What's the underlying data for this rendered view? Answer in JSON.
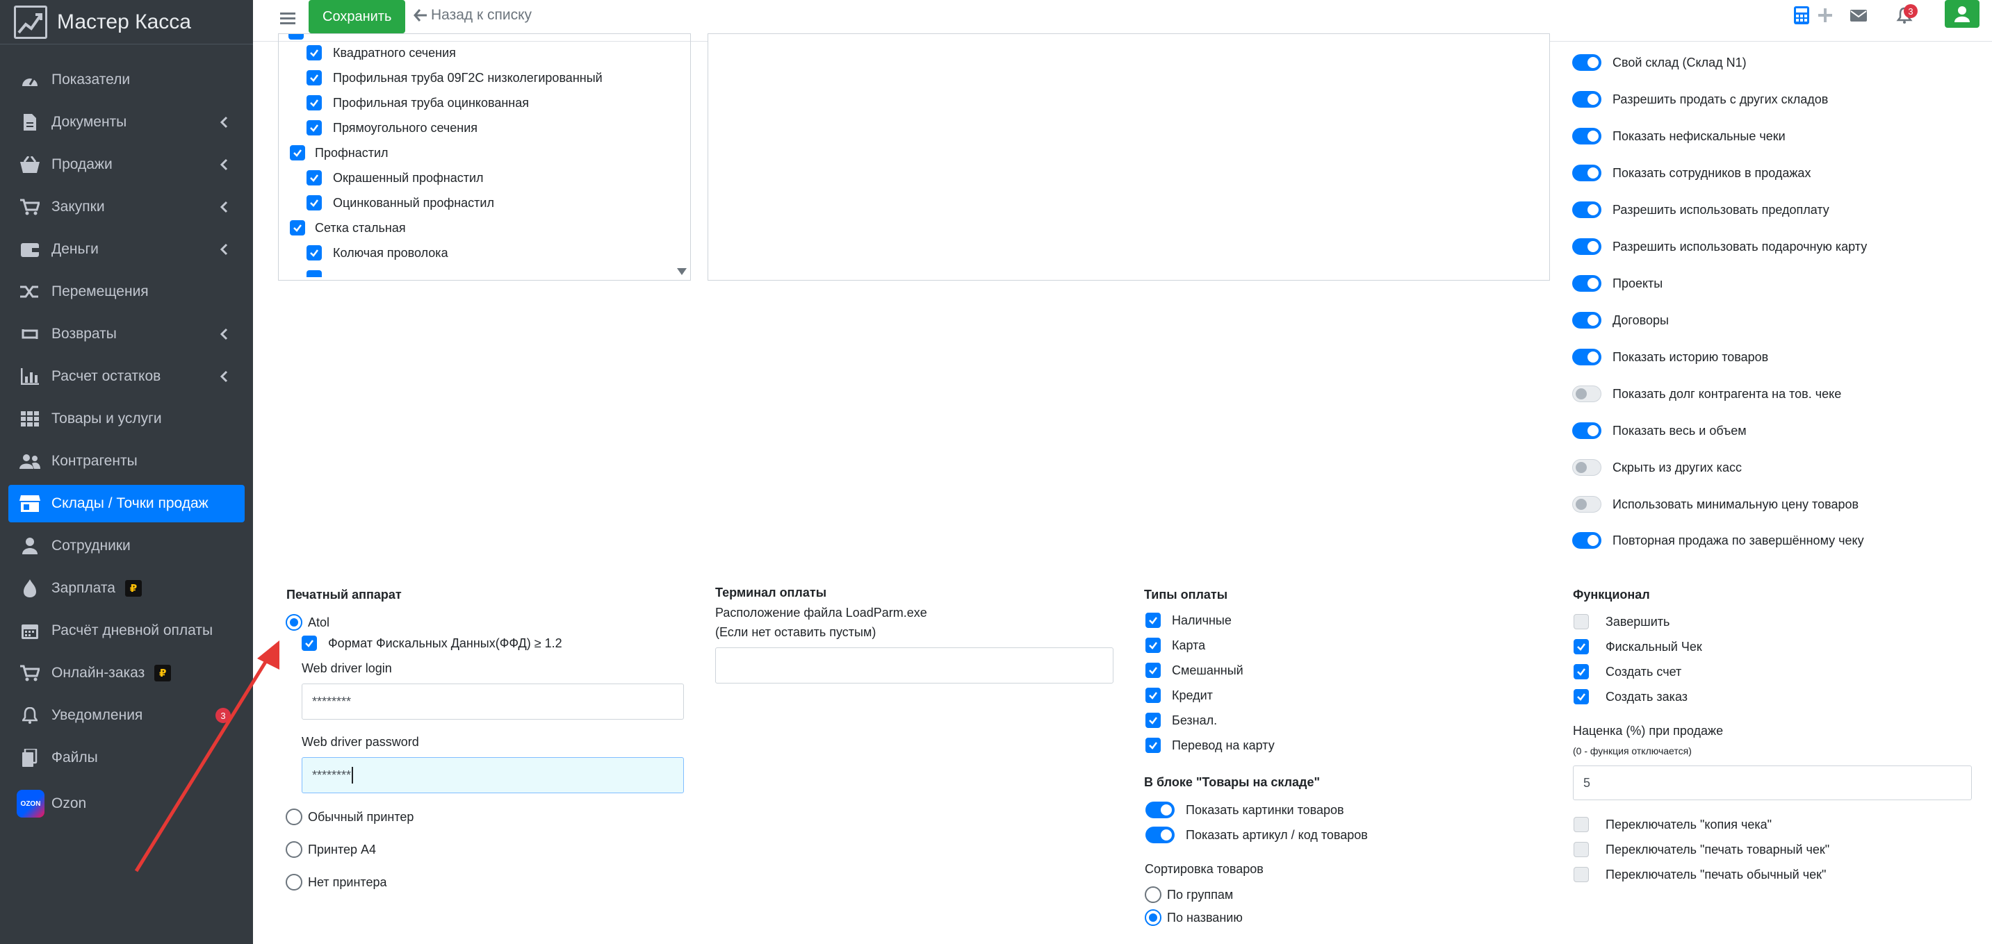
{
  "brand": {
    "name": "Мастер Касса"
  },
  "sidebar": {
    "items": [
      {
        "label": "Показатели",
        "icon": "gauge-icon"
      },
      {
        "label": "Документы",
        "icon": "file-icon",
        "has_children": true
      },
      {
        "label": "Продажи",
        "icon": "basket-icon",
        "has_children": true
      },
      {
        "label": "Закупки",
        "icon": "cart-icon",
        "has_children": true
      },
      {
        "label": "Деньги",
        "icon": "wallet-icon",
        "has_children": true
      },
      {
        "label": "Перемещения",
        "icon": "shuffle-icon"
      },
      {
        "label": "Возвраты",
        "icon": "return-icon",
        "has_children": true
      },
      {
        "label": "Расчет остатков",
        "icon": "chart-icon",
        "has_children": true
      },
      {
        "label": "Товары и услуги",
        "icon": "grid-icon"
      },
      {
        "label": "Контрагенты",
        "icon": "users-icon"
      },
      {
        "label": "Склады / Точки продаж",
        "icon": "store-icon",
        "active": true
      },
      {
        "label": "Сотрудники",
        "icon": "user-icon"
      },
      {
        "label": "Зарплата",
        "icon": "money-icon",
        "rub": "₽"
      },
      {
        "label": "Расчёт дневной оплаты",
        "icon": "calendar-icon"
      },
      {
        "label": "Онлайн-заказ",
        "icon": "cart-icon",
        "rub": "₽"
      },
      {
        "label": "Уведомления",
        "icon": "bell-icon",
        "badge": "3"
      },
      {
        "label": "Файлы",
        "icon": "folder-icon"
      },
      {
        "label": "Ozon",
        "icon": "ozon-logo",
        "logo_text": "OZON"
      }
    ]
  },
  "header": {
    "save_label": "Сохранить",
    "back_label": "Назад к списку",
    "notif_count": "3"
  },
  "category_tree": [
    {
      "label": "Квадратного сечения",
      "level": 2,
      "checked": true
    },
    {
      "label": "Профильная труба 09Г2С низколегированный",
      "level": 2,
      "checked": true
    },
    {
      "label": "Профильная труба оцинкованная",
      "level": 2,
      "checked": true
    },
    {
      "label": "Прямоугольного сечения",
      "level": 2,
      "checked": true
    },
    {
      "label": "Профнастил",
      "level": 1,
      "checked": true
    },
    {
      "label": "Окрашенный профнастил",
      "level": 2,
      "checked": true
    },
    {
      "label": "Оцинкованный профнастил",
      "level": 2,
      "checked": true
    },
    {
      "label": "Сетка стальная",
      "level": 1,
      "checked": true
    },
    {
      "label": "Колючая проволока",
      "level": 2,
      "checked": true
    }
  ],
  "toggles": [
    {
      "label": "Свой склад (Склад N1)",
      "on": true
    },
    {
      "label": "Разрешить продать с других складов",
      "on": true
    },
    {
      "label": "Показать нефискальные чеки",
      "on": true
    },
    {
      "label": "Показать сотрудников в продажах",
      "on": true
    },
    {
      "label": "Разрешить использовать предоплату",
      "on": true
    },
    {
      "label": "Разрешить использовать подарочную карту",
      "on": true
    },
    {
      "label": "Проекты",
      "on": true
    },
    {
      "label": "Договоры",
      "on": true
    },
    {
      "label": "Показать историю товаров",
      "on": true
    },
    {
      "label": "Показать долг контрагента на тов. чеке",
      "on": false
    },
    {
      "label": "Показать весь и объем",
      "on": true
    },
    {
      "label": "Скрыть из других касс",
      "on": false
    },
    {
      "label": "Использовать минимальную цену товаров",
      "on": false
    },
    {
      "label": "Повторная продажа по завершённому чеку",
      "on": true
    }
  ],
  "printer": {
    "title": "Печатный аппарат",
    "atol_label": "Atol",
    "ffd_label": "Формат Фискальных Данных(ФФД) ≥ 1.2",
    "login_label": "Web driver login",
    "login_value": "********",
    "password_label": "Web driver password",
    "password_value": "********",
    "options": [
      "Обычный принтер",
      "Принтер A4",
      "Нет принтера"
    ]
  },
  "terminal": {
    "title": "Терминал оплаты",
    "desc1": "Расположение файла LoadParm.exe",
    "desc2": "(Если нет оставить пустым)",
    "value": ""
  },
  "payment_types": {
    "title": "Типы оплаты",
    "items": [
      "Наличные",
      "Карта",
      "Смешанный",
      "Кредит",
      "Безнал.",
      "Перевод на карту"
    ]
  },
  "stock_block": {
    "title": "В блоке \"Товары на складе\"",
    "toggles": [
      "Показать картинки товаров",
      "Показать артикул / код товаров"
    ],
    "sort_title": "Сортировка товаров",
    "sort_options": [
      "По группам",
      "По названию"
    ],
    "sort_selected": 1
  },
  "functional": {
    "title": "Функционал",
    "items": [
      {
        "label": "Завершить",
        "checked": false
      },
      {
        "label": "Фискальный Чек",
        "checked": true
      },
      {
        "label": "Создать счет",
        "checked": true
      },
      {
        "label": "Создать заказ",
        "checked": true
      }
    ],
    "markup_label": "Наценка (%) при продаже",
    "markup_hint": "(0 - функция отключается)",
    "markup_value": "5",
    "switches": [
      "Переключатель \"копия чека\"",
      "Переключатель \"печать товарный чек\"",
      "Переключатель \"печать обычный чек\""
    ]
  },
  "colors": {
    "sidebar": "#343a40",
    "accent": "#007bff",
    "save": "#28a745",
    "arrow": "#e53935"
  }
}
